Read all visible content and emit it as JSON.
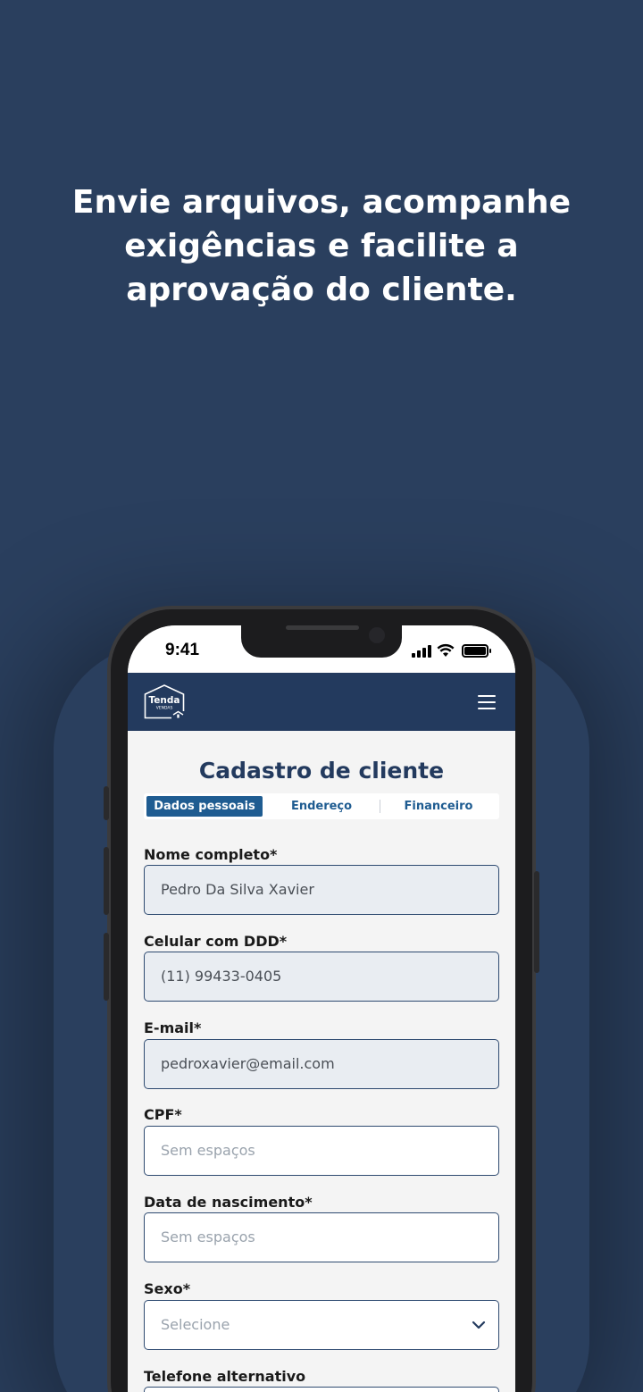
{
  "headline": {
    "line1": "Envie arquivos, acompanhe",
    "line2": "exigências e facilite a",
    "line3": "aprovação do cliente."
  },
  "status_bar": {
    "time": "9:41"
  },
  "app": {
    "logo": {
      "text": "Tenda",
      "subtext": "VENDAS"
    },
    "menu_icon": "hamburger-icon"
  },
  "form": {
    "title": "Cadastro de cliente",
    "tabs": [
      {
        "label": "Dados pessoais",
        "active": true
      },
      {
        "label": "Endereço",
        "active": false
      },
      {
        "label": "Financeiro",
        "active": false
      }
    ],
    "fields": [
      {
        "label": "Nome completo*",
        "value": "Pedro Da Silva Xavier"
      },
      {
        "label": "Celular com DDD*",
        "value": "(11) 99433-0405"
      },
      {
        "label": "E-mail*",
        "value": "pedroxavier@email.com"
      },
      {
        "label": "CPF*",
        "placeholder": "Sem espaços"
      },
      {
        "label": "Data de nascimento*",
        "placeholder": "Sem espaços"
      },
      {
        "label": "Sexo*",
        "placeholder": "Selecione",
        "type": "select"
      },
      {
        "label": "Telefone alternativo"
      }
    ]
  },
  "colors": {
    "background": "#2a3f5e",
    "header": "#233a5e",
    "accent": "#1f5c91"
  }
}
